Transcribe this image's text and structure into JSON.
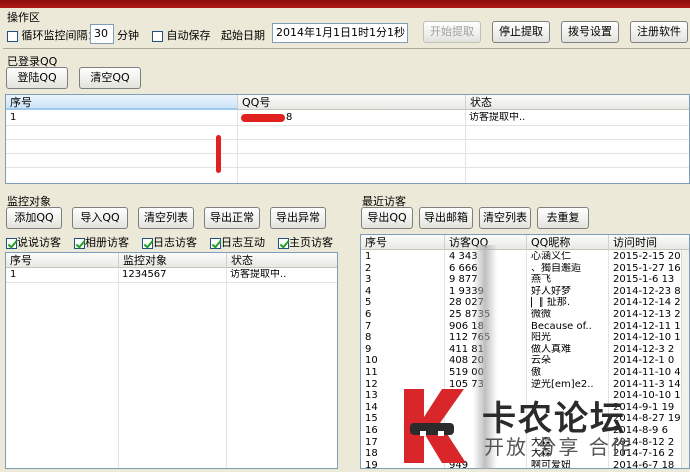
{
  "top": {
    "group_title": "操作区",
    "loop_label": "循环监控间隔：",
    "loop_checked": false,
    "interval_value": "30",
    "interval_unit": "分钟",
    "autosave_label": "自动保存",
    "autosave_checked": false,
    "start_date_label": "起始日期",
    "start_date_value": "2014年1月1日1时1分1秒",
    "btn_start": "开始提取",
    "btn_stop": "停止提取",
    "btn_dial": "拨号设置",
    "btn_register": "注册软件"
  },
  "logged": {
    "title": "已登录QQ",
    "btn_login": "登陆QQ",
    "btn_clear": "清空QQ",
    "columns": [
      "序号",
      "QQ号",
      "状态"
    ],
    "rows": [
      {
        "no": "1",
        "qq": "8",
        "status": "访客提取中.."
      }
    ]
  },
  "monitor": {
    "title": "监控对象",
    "buttons": [
      "添加QQ",
      "导入QQ",
      "清空列表",
      "导出正常",
      "导出异常"
    ],
    "checks": [
      {
        "label": "说说访客",
        "on": true
      },
      {
        "label": "相册访客",
        "on": true
      },
      {
        "label": "日志访客",
        "on": true
      },
      {
        "label": "日志互动",
        "on": true
      },
      {
        "label": "主页访客",
        "on": true
      }
    ],
    "columns": [
      "序号",
      "监控对象",
      "状态"
    ],
    "rows": [
      {
        "no": "1",
        "target": "1234567",
        "status": "访客提取中.."
      }
    ]
  },
  "recent": {
    "title": "最近访客",
    "buttons": [
      "导出QQ",
      "导出邮箱",
      "清空列表",
      "去重复"
    ],
    "columns": [
      "序号",
      "访客QQ",
      "QQ昵称",
      "访问时间"
    ],
    "rows": [
      {
        "no": "1",
        "qq": "4    343",
        "nick": "心涵义仁",
        "time": "2015-2-15 20"
      },
      {
        "no": "2",
        "qq": "6    666",
        "nick": "、獨自邂逅",
        "time": "2015-1-27 16"
      },
      {
        "no": "3",
        "qq": "9    877",
        "nick": "燕飞",
        "time": "2015-1-6 13"
      },
      {
        "no": "4",
        "qq": "1    9339",
        "nick": "好人好梦",
        "time": "2014-12-23 8"
      },
      {
        "no": "5",
        "qq": "28    027",
        "nick": "▏∥ 扯那.",
        "time": "2014-12-14 2"
      },
      {
        "no": "6",
        "qq": "25    8735",
        "nick": "微微",
        "time": "2014-12-13 2"
      },
      {
        "no": "7",
        "qq": "906    18",
        "nick": "Because of..",
        "time": "2014-12-11 1"
      },
      {
        "no": "8",
        "qq": "112    765",
        "nick": "阳光",
        "time": "2014-12-10 1"
      },
      {
        "no": "9",
        "qq": "411    81",
        "nick": "做人真难",
        "time": "2014-12-3 2"
      },
      {
        "no": "10",
        "qq": "408    20",
        "nick": "云朵",
        "time": "2014-12-1 0"
      },
      {
        "no": "11",
        "qq": "519    00",
        "nick": "傲",
        "time": "2014-11-10 4"
      },
      {
        "no": "12",
        "qq": "105    73",
        "nick": "逆光[em]e2..",
        "time": "2014-11-3 14"
      },
      {
        "no": "13",
        "qq": "",
        "nick": "",
        "time": "2014-10-10 1"
      },
      {
        "no": "14",
        "qq": "",
        "nick": "",
        "time": "2014-9-1 19"
      },
      {
        "no": "15",
        "qq": "",
        "nick": "",
        "time": "2014-8-27 19"
      },
      {
        "no": "16",
        "qq": "",
        "nick": "",
        "time": "2014-8-9 6"
      },
      {
        "no": "17",
        "qq": "",
        "nick": "大森",
        "time": "2014-8-12 2"
      },
      {
        "no": "18",
        "qq": "",
        "nick": "大森",
        "time": "2014-7-16 2"
      },
      {
        "no": "19",
        "qq": "949",
        "nick": "啊可爱妞",
        "time": "2014-6-7 18"
      }
    ]
  },
  "watermark": {
    "brand_big": "卡农论坛",
    "brand_small": "开放 分享 合作",
    "colors": {
      "red": "#d8262a",
      "dark": "#2b2b2b"
    }
  }
}
